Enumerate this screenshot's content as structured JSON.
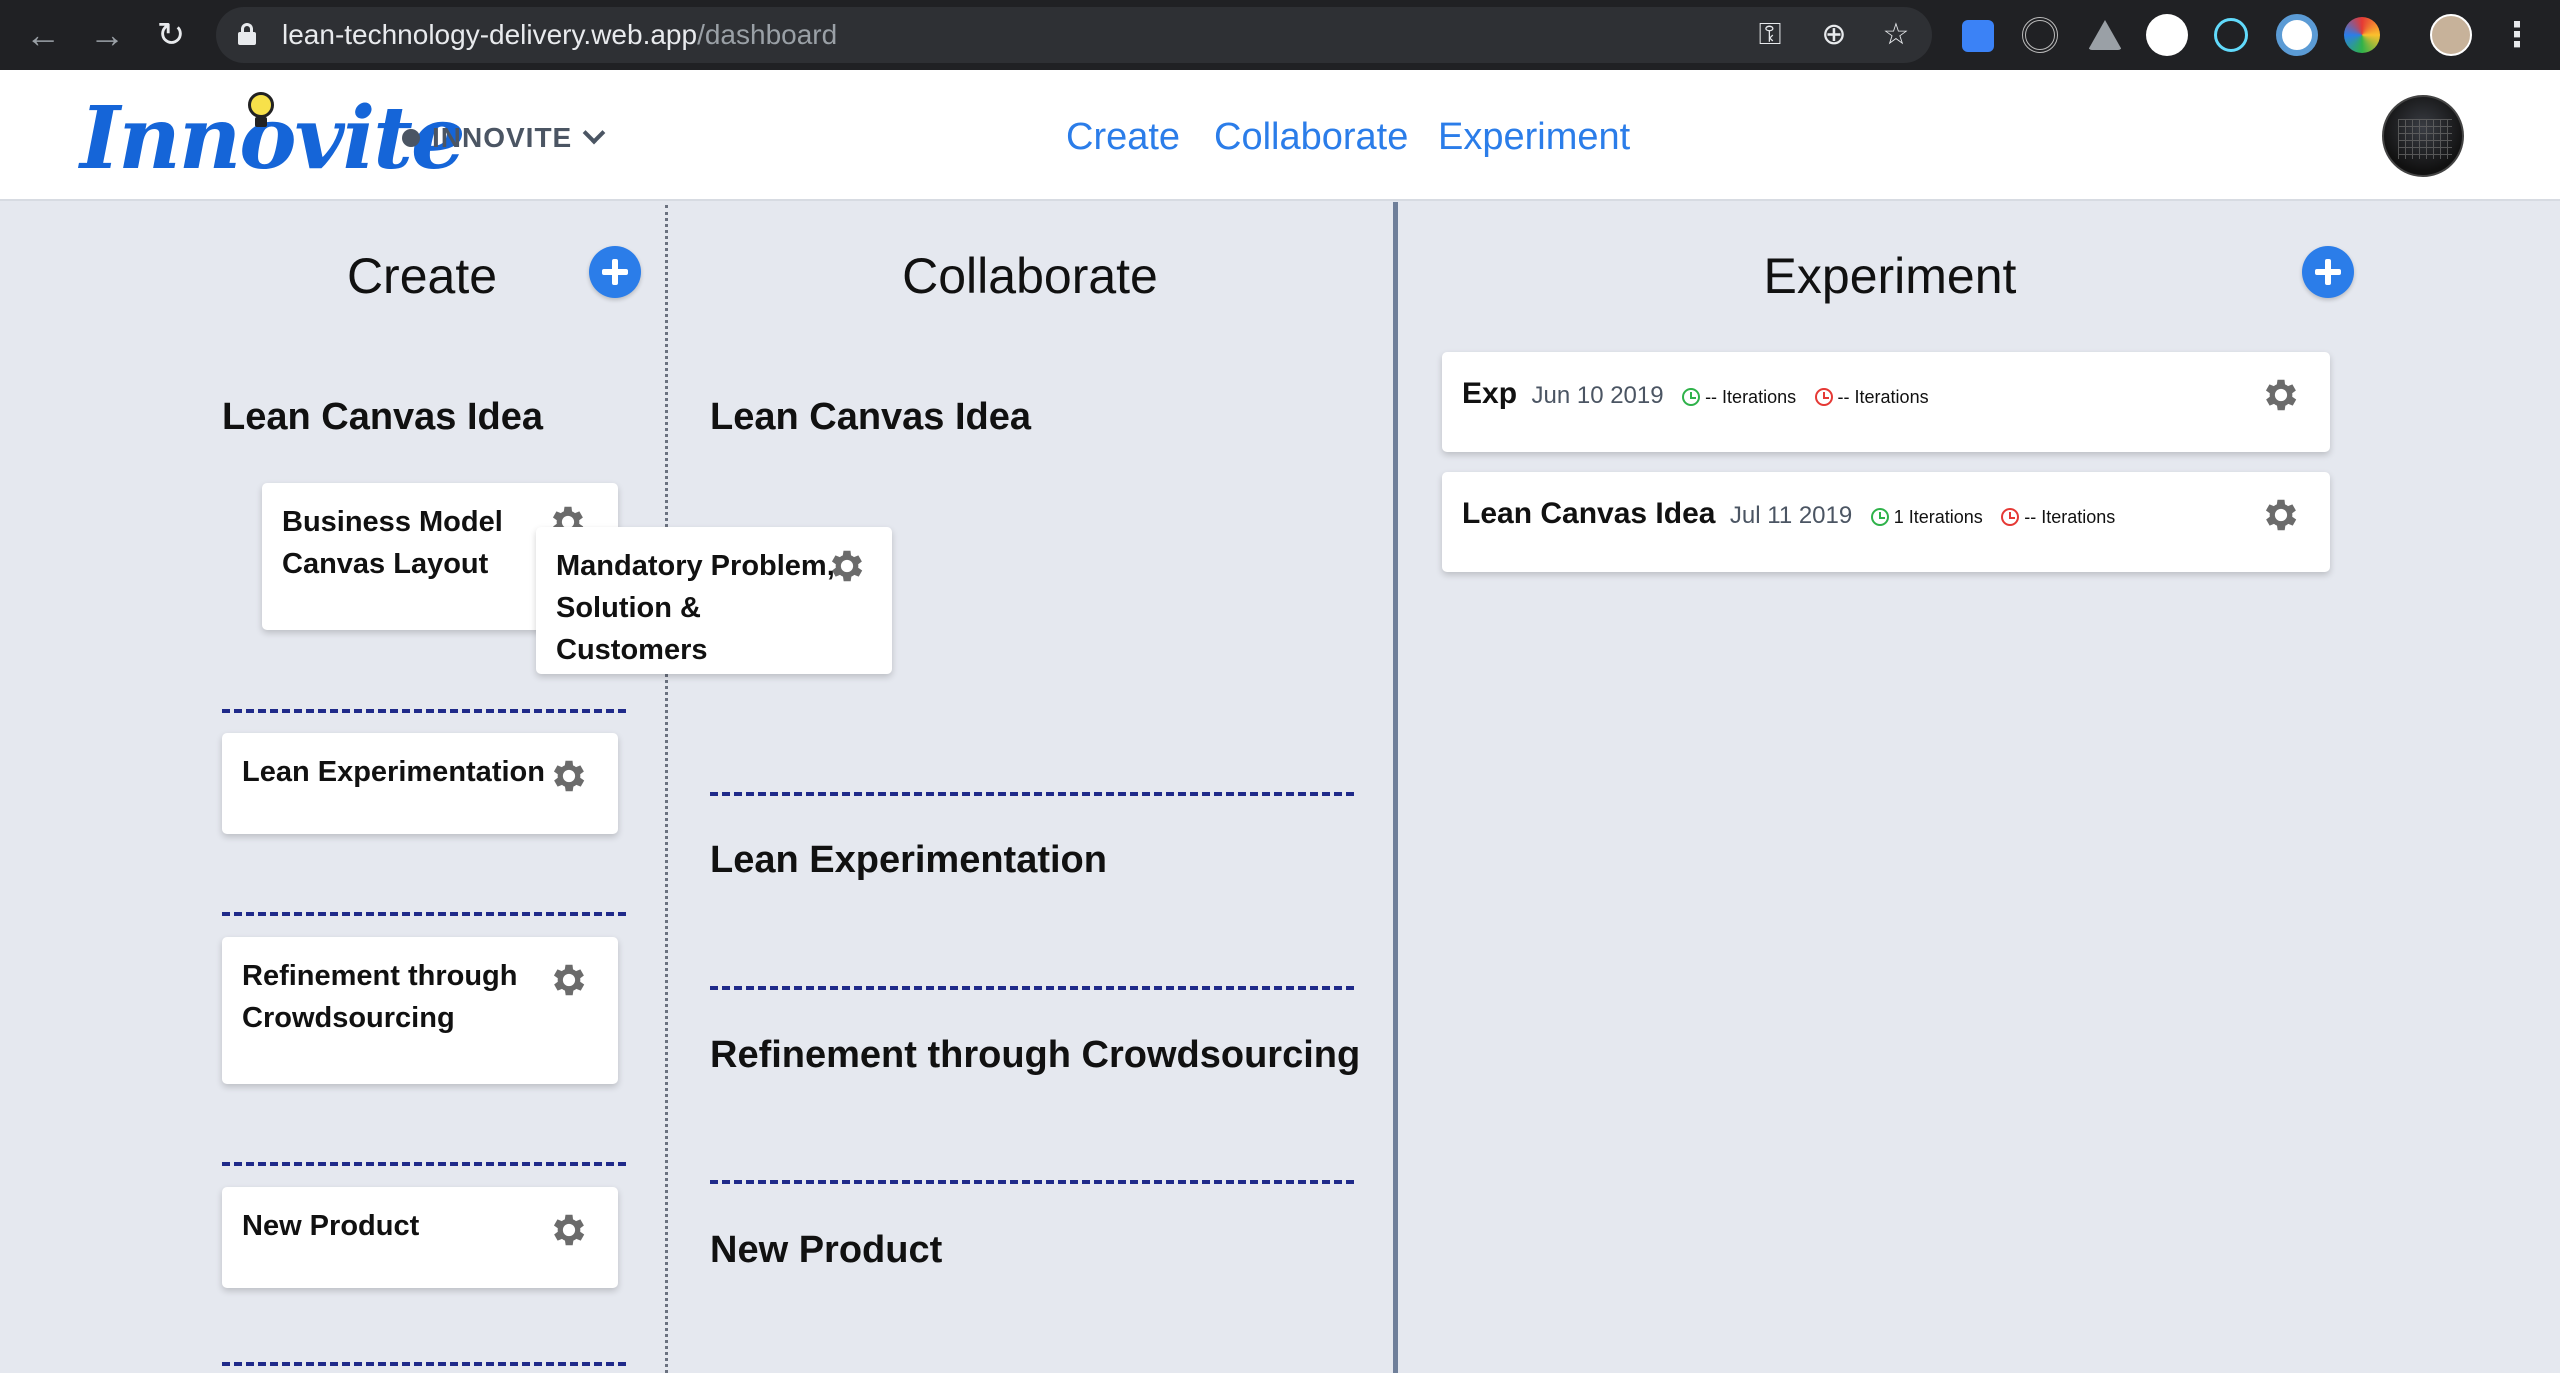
{
  "browser": {
    "url_domain": "lean-technology-delivery.web.app",
    "url_path": "/dashboard"
  },
  "header": {
    "logo_text": "Innovite",
    "workspace": "INNOVITE",
    "nav": [
      "Create",
      "Collaborate",
      "Experiment"
    ]
  },
  "columns": {
    "create": {
      "title": "Create",
      "sections": [
        {
          "title": "Lean Canvas Idea",
          "cards": [
            "Business Model Canvas Layout",
            "Mandatory Problem, Solution & Customers"
          ]
        },
        {
          "title": "Lean Experimentation",
          "cards": [
            "Lean Experimentation"
          ]
        },
        {
          "title": "Refinement through Crowdsourcing",
          "cards": [
            "Refinement through Crowdsourcing"
          ]
        },
        {
          "title": "New Product",
          "cards": [
            "New Product"
          ]
        }
      ]
    },
    "collaborate": {
      "title": "Collaborate",
      "sections": [
        "Lean Canvas Idea",
        "Lean Experimentation",
        "Refinement through Crowdsourcing",
        "New Product"
      ]
    },
    "experiment": {
      "title": "Experiment",
      "cards": [
        {
          "name": "Exp",
          "date": "Jun 10 2019",
          "success": "-- Iterations",
          "fail": "-- Iterations"
        },
        {
          "name": "Lean Canvas Idea",
          "date": "Jul 11 2019",
          "success": "1 Iterations",
          "fail": "-- Iterations"
        }
      ]
    }
  },
  "icons": {
    "gear": "gear-icon",
    "add": "plus-circle-icon"
  },
  "colors": {
    "accent": "#2b7de9",
    "logo": "#1565d8",
    "divider_dashed": "#1f2a8a",
    "success": "#2fb24a",
    "fail": "#e53935"
  }
}
